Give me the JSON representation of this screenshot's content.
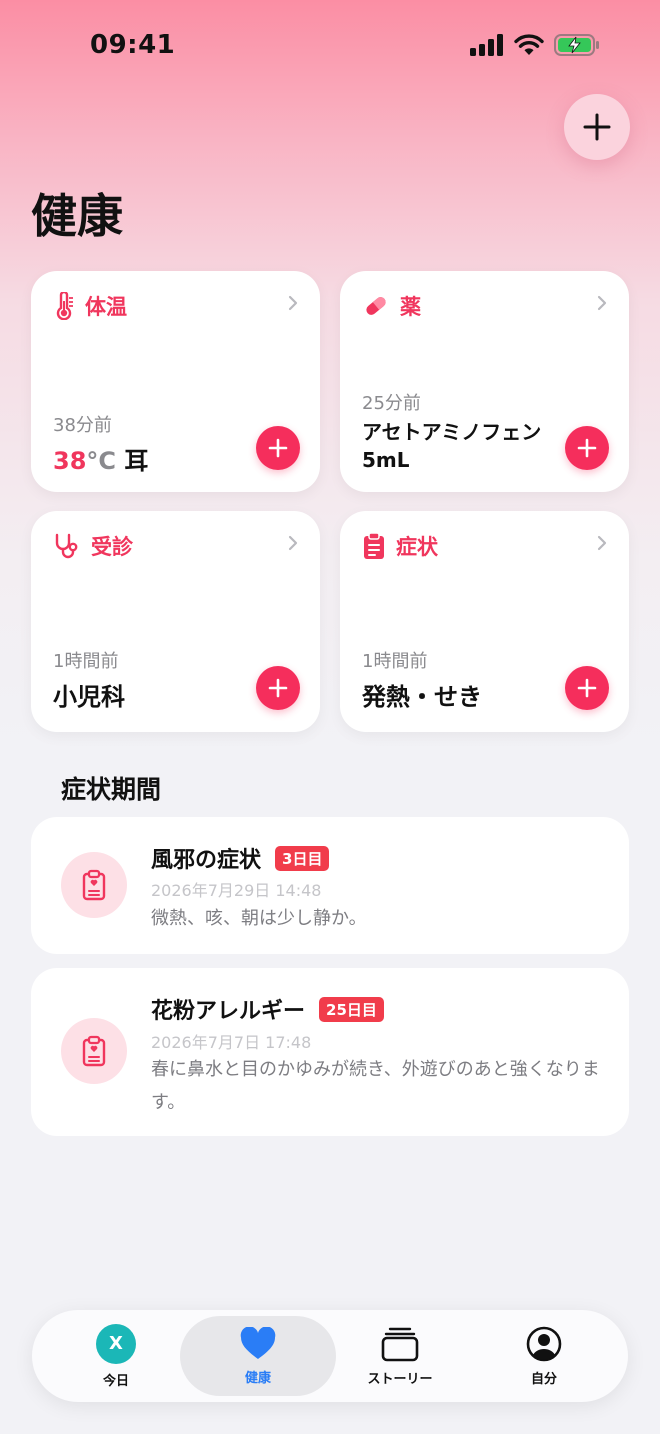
{
  "status_bar": {
    "time": "09:41"
  },
  "header": {
    "title": "健康"
  },
  "cards": [
    {
      "title": "体温",
      "icon": "thermometer-icon",
      "time": "38分前",
      "value_number": "38",
      "value_unit": "°C",
      "value_suffix": " 耳"
    },
    {
      "title": "薬",
      "icon": "pill-icon",
      "time": "25分前",
      "value": "アセトアミノフェン 5mL"
    },
    {
      "title": "受診",
      "icon": "stethoscope-icon",
      "time": "1時間前",
      "value": "小児科"
    },
    {
      "title": "症状",
      "icon": "clipboard-icon",
      "time": "1時間前",
      "value": "発熱・せき"
    }
  ],
  "symptom_periods": {
    "section_title": "症状期間",
    "items": [
      {
        "name": "風邪の症状",
        "badge": "3日目",
        "date": "2026年7月29日 14:48",
        "description": "微熱、咳、朝は少し静か。"
      },
      {
        "name": "花粉アレルギー",
        "badge": "25日目",
        "date": "2026年7月7日 17:48",
        "description": "春に鼻水と目のかゆみが続き、外遊びのあと強くなります。"
      }
    ]
  },
  "tab_bar": {
    "tabs": [
      {
        "label": "今日",
        "avatar_letter": "X"
      },
      {
        "label": "健康"
      },
      {
        "label": "ストーリー"
      },
      {
        "label": "自分"
      }
    ],
    "active_color": "#2a7df6"
  },
  "colors": {
    "accent": "#f52e5c",
    "badge": "#f13c4b"
  }
}
